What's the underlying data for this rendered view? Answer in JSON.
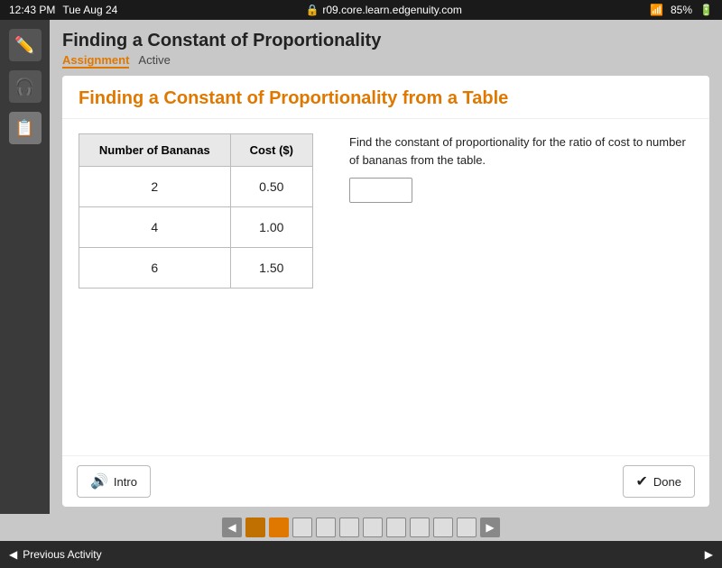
{
  "statusBar": {
    "time": "12:43 PM",
    "day": "Tue Aug 24",
    "url": "r09.core.learn.edgenuity.com",
    "battery": "85%"
  },
  "pageTitle": "Finding a Constant of Proportionality",
  "tabs": [
    {
      "label": "Assignment",
      "active": true
    },
    {
      "label": "Active",
      "active": false
    }
  ],
  "card": {
    "title": "Finding a Constant of Proportionality from a Table",
    "tableHeaders": [
      "Number of Bananas",
      "Cost ($)"
    ],
    "tableRows": [
      {
        "bananas": "2",
        "cost": "0.50"
      },
      {
        "bananas": "4",
        "cost": "1.00"
      },
      {
        "bananas": "6",
        "cost": "1.50"
      }
    ],
    "questionText": "Find the constant of proportionality for the ratio of cost to number of bananas from the table.",
    "answerPlaceholder": "",
    "introButton": "Intro",
    "doneButton": "Done"
  },
  "pagination": {
    "pageInfo": "2 of 10",
    "totalDots": 10,
    "activeDot": 2
  },
  "bottomBar": {
    "prevActivity": "Previous Activity"
  }
}
